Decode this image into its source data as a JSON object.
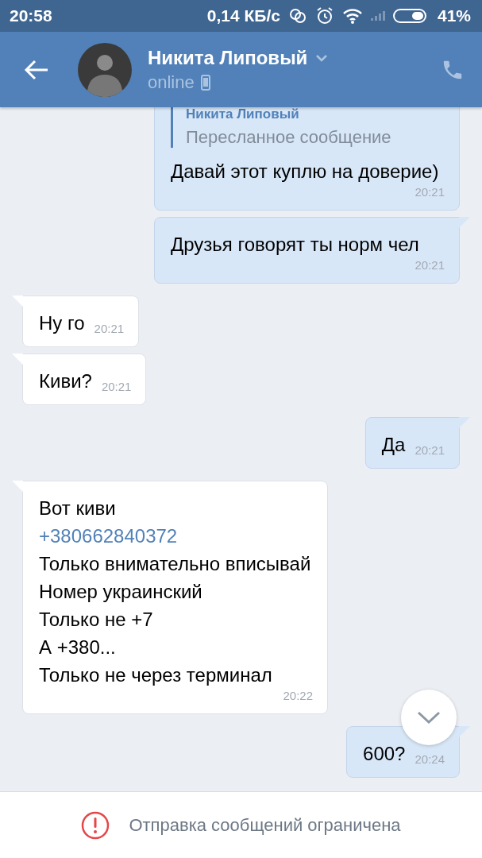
{
  "status_bar": {
    "time": "20:58",
    "speed": "0,14 КБ/с",
    "battery": "41%"
  },
  "header": {
    "name": "Никита Липовый",
    "status": "online"
  },
  "messages": [
    {
      "kind": "out",
      "forwarded": {
        "author": "Никита Липовый",
        "label": "Пересланное сообщение"
      },
      "lines": [
        {
          "kind": "text",
          "text": "Давай этот куплю на доверие)"
        }
      ],
      "time": "20:21"
    },
    {
      "kind": "out",
      "lines": [
        {
          "kind": "text",
          "text": "Друзья говорят ты норм чел"
        }
      ],
      "time": "20:21"
    },
    {
      "kind": "in",
      "lines": [
        {
          "kind": "text",
          "text": "Ну го"
        }
      ],
      "time": "20:21"
    },
    {
      "kind": "in",
      "lines": [
        {
          "kind": "text",
          "text": "Киви?"
        }
      ],
      "time": "20:21"
    },
    {
      "kind": "out",
      "lines": [
        {
          "kind": "text",
          "text": "Да"
        }
      ],
      "time": "20:21"
    },
    {
      "kind": "in",
      "lines": [
        {
          "kind": "text",
          "text": "Вот киви"
        },
        {
          "kind": "link",
          "text": "+380662840372"
        },
        {
          "kind": "text",
          "text": "Только внимательно вписывай"
        },
        {
          "kind": "text",
          "text": "Номер украинский"
        },
        {
          "kind": "text",
          "text": "Только не +7"
        },
        {
          "kind": "text",
          "text": "А +380..."
        },
        {
          "kind": "text",
          "text": "Только не через терминал"
        }
      ],
      "time": "20:22"
    },
    {
      "kind": "out",
      "lines": [
        {
          "kind": "text",
          "text": "600?"
        }
      ],
      "time": "20:24"
    }
  ],
  "footer": {
    "notice": "Отправка сообщений ограничена"
  }
}
